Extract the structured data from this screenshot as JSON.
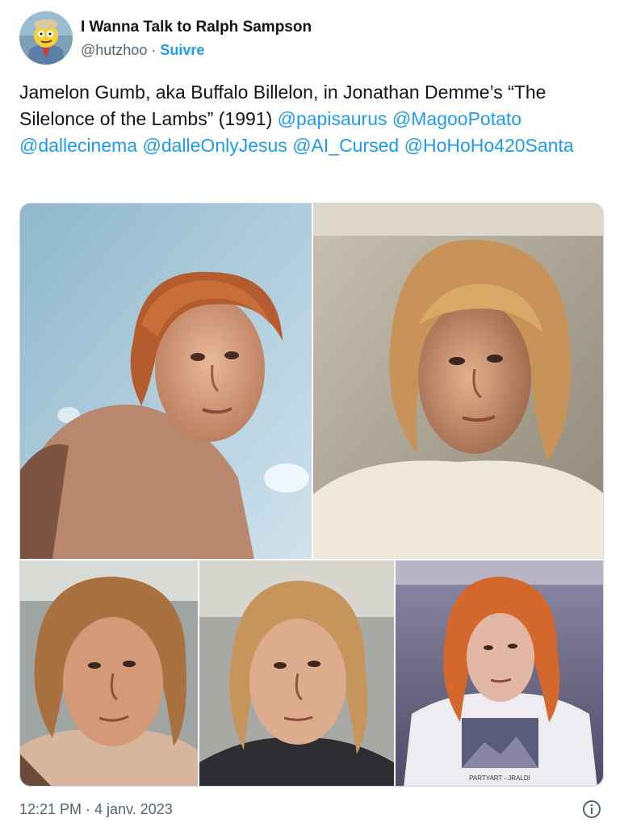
{
  "author": {
    "display_name": "I Wanna Talk to Ralph Sampson",
    "handle": "@hutzhoo",
    "separator": " · ",
    "follow_label": "Suivre",
    "avatar_icon": "cartoon-avatar-icon"
  },
  "tweet": {
    "text_before": "Jamelon Gumb, aka Buffalo Billelon, in Jonathan Demme’s “The Silelonce of the Lambs” (1991) ",
    "mentions": [
      "@papisaurus",
      "@MagooPotato",
      "@dallecinema",
      "@dalleOnlyJesus",
      "@AI_Cursed",
      "@HoHoHo420Santa"
    ]
  },
  "media": {
    "photo_count": 5,
    "photo_5_shirt_text": "PARTYART - JRALDI"
  },
  "footer": {
    "timestamp": "12:21 PM · 4 janv. 2023",
    "info_icon": "info-icon"
  },
  "colors": {
    "link": "#1d9bf0",
    "text": "#0f1419",
    "muted": "#536471"
  }
}
